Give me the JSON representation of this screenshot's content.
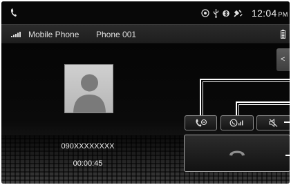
{
  "status_bar": {
    "clock_time": "12:04",
    "clock_ampm": "PM",
    "icons": [
      "phone-icon",
      "location-icon",
      "usb-icon",
      "bluetooth-icon",
      "satellite-icon"
    ]
  },
  "info_bar": {
    "device_label": "Mobile Phone",
    "phone_name": "Phone 001",
    "signal_icon": "signal-strength-icon",
    "battery_icon": "battery-icon"
  },
  "call": {
    "number": "090XXXXXXXX",
    "duration": "00:00:45"
  },
  "controls": {
    "side_tab_symbol": "<",
    "buttons": [
      "redial-icon",
      "phone-speaker-icon",
      "mute-icon",
      "end-call-icon"
    ]
  },
  "colors": {
    "background": "#050505",
    "button_border": "#8d8d8d",
    "callout_line": "#ffffff"
  }
}
